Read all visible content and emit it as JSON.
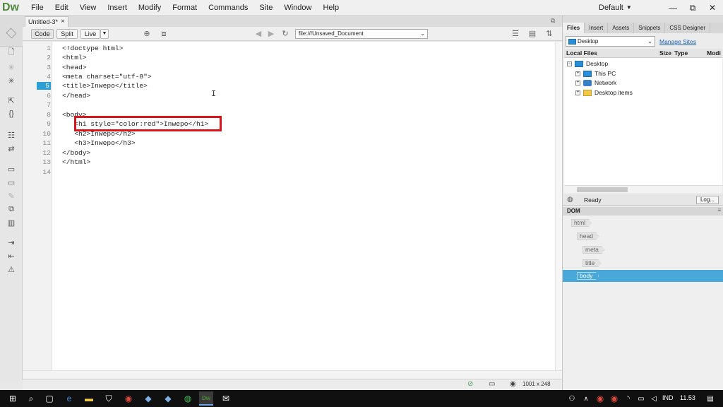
{
  "app": {
    "logo": "Dw",
    "menu": [
      "File",
      "Edit",
      "View",
      "Insert",
      "Modify",
      "Format",
      "Commands",
      "Site",
      "Window",
      "Help"
    ],
    "workspace": "Default",
    "window_controls": [
      "—",
      "⧉",
      "✕"
    ]
  },
  "document": {
    "tab_title": "Untitled-3*",
    "tab_close": "×",
    "view_buttons": [
      "Code",
      "Split",
      "Live"
    ],
    "address": "file:///Unsaved_Document"
  },
  "code": {
    "current_line": 5,
    "lines": [
      {
        "num": "1",
        "text": "<!doctype html>"
      },
      {
        "num": "2",
        "text": "<html>"
      },
      {
        "num": "3",
        "text": "<head>"
      },
      {
        "num": "4",
        "text": "<meta charset=\"utf-8\">"
      },
      {
        "num": "5",
        "text": "<title>Inwepo</title>"
      },
      {
        "num": "6",
        "text": "</head>"
      },
      {
        "num": "7",
        "text": ""
      },
      {
        "num": "8",
        "text": "<body>"
      },
      {
        "num": "9",
        "text": "   <h1 style=\"color:red\">Inwepo</h1>"
      },
      {
        "num": "10",
        "text": "   <h2>Inwepo</h2>"
      },
      {
        "num": "11",
        "text": "   <h3>Inwepo</h3>"
      },
      {
        "num": "12",
        "text": "</body>"
      },
      {
        "num": "13",
        "text": "</html>"
      },
      {
        "num": "14",
        "text": ""
      }
    ],
    "highlight_color": "#d8151b"
  },
  "status": {
    "dimensions": "1001 x 248"
  },
  "files_panel": {
    "tabs": [
      "Files",
      "Insert",
      "Assets",
      "Snippets",
      "CSS Designer"
    ],
    "site": "Desktop",
    "manage_sites": "Manage Sites",
    "columns": [
      "Local Files",
      "Size",
      "Type",
      "Modi"
    ],
    "tree": [
      {
        "toggle": "−",
        "label": "Desktop",
        "icon": "monitor-icon"
      },
      {
        "toggle": "+",
        "label": "This PC",
        "icon": "monitor-icon"
      },
      {
        "toggle": "+",
        "label": "Network",
        "icon": "network-icon"
      },
      {
        "toggle": "+",
        "label": "Desktop items",
        "icon": "folder-icon"
      }
    ],
    "ready": "Ready",
    "log_button": "Log..."
  },
  "dom_panel": {
    "title": "DOM",
    "nodes": [
      "html",
      "head",
      "meta",
      "title",
      "body"
    ],
    "selected": "body",
    "selected_color": "#4aa8d8"
  },
  "taskbar": {
    "language": "IND",
    "time": "11.53"
  }
}
